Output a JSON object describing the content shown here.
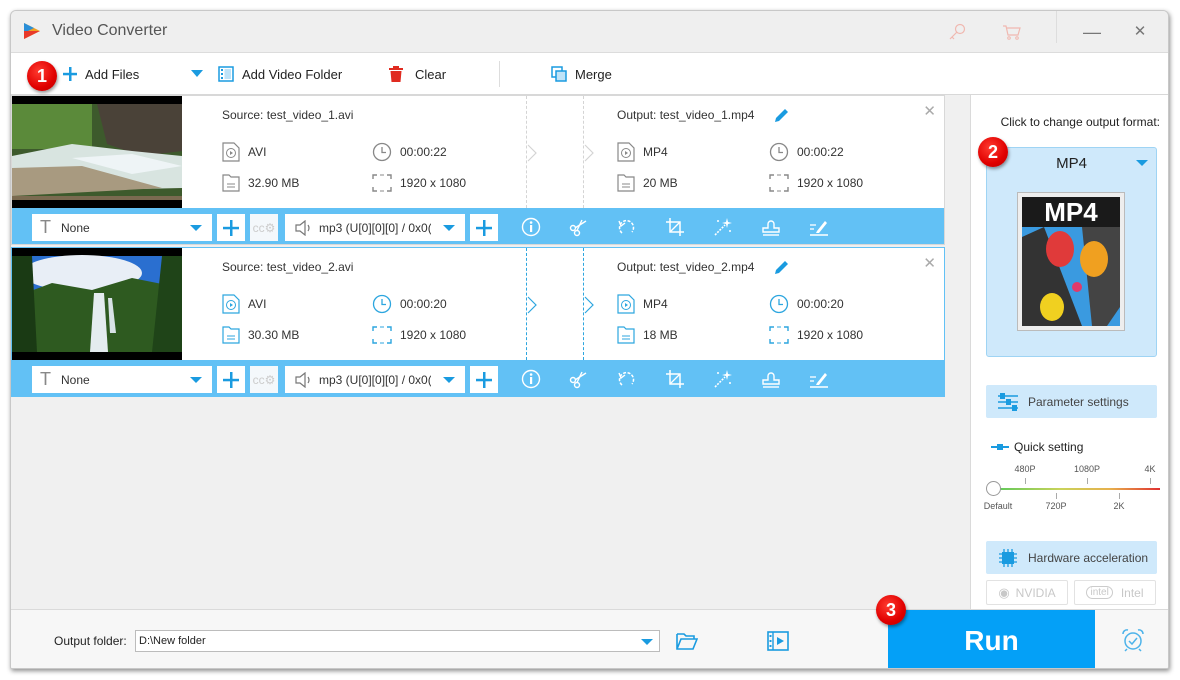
{
  "window": {
    "title": "Video Converter",
    "controls": {
      "minimize": "—",
      "close": "✕"
    }
  },
  "toolbar": {
    "add_files": "Add Files",
    "add_video_folder": "Add Video Folder",
    "clear": "Clear",
    "merge": "Merge"
  },
  "badges": {
    "step1": "1",
    "step2": "2",
    "step3": "3"
  },
  "items": [
    {
      "source_title": "Source: test_video_1.avi",
      "source": {
        "format": "AVI",
        "duration": "00:00:22",
        "size": "32.90 MB",
        "resolution": "1920 x 1080"
      },
      "output_title": "Output: test_video_1.mp4",
      "output": {
        "format": "MP4",
        "duration": "00:00:22",
        "size": "20 MB",
        "resolution": "1920 x 1080"
      },
      "subtitle": "None",
      "audio": "mp3 (U[0][0][0] / 0x0(",
      "selected": false
    },
    {
      "source_title": "Source: test_video_2.avi",
      "source": {
        "format": "AVI",
        "duration": "00:00:20",
        "size": "30.30 MB",
        "resolution": "1920 x 1080"
      },
      "output_title": "Output: test_video_2.mp4",
      "output": {
        "format": "MP4",
        "duration": "00:00:20",
        "size": "18 MB",
        "resolution": "1920 x 1080"
      },
      "subtitle": "None",
      "audio": "mp3 (U[0][0][0] / 0x0(",
      "selected": true
    }
  ],
  "right_panel": {
    "label": "Click to change output format:",
    "format": "MP4",
    "format_image_text": "MP4",
    "parameter_settings": "Parameter settings",
    "quick_setting": "Quick setting",
    "quality_top_labels": [
      "480P",
      "1080P",
      "4K"
    ],
    "quality_bottom_labels": [
      "Default",
      "720P",
      "2K"
    ],
    "quality_selected": "Default",
    "hardware_acceleration": "Hardware acceleration",
    "gpu_nvidia": "NVIDIA",
    "gpu_intel": "Intel"
  },
  "bottom": {
    "output_folder_label": "Output folder:",
    "output_folder_value": "D:\\New folder",
    "run": "Run"
  },
  "colors": {
    "accent": "#04a0f7",
    "item_bar": "#62c1f5",
    "format_box": "#cfe9fb",
    "badge": "#e00000"
  }
}
